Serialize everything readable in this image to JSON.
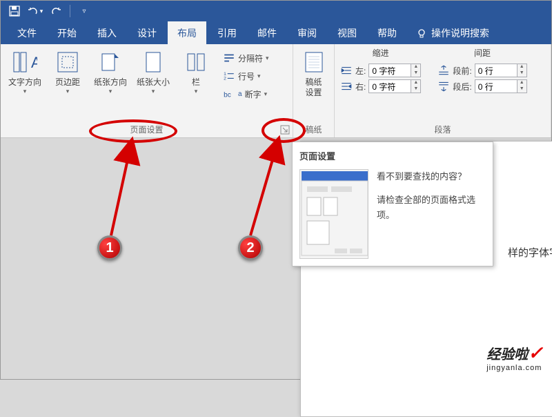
{
  "qat": {
    "save": "保存",
    "undo": "撤销",
    "redo": "重做"
  },
  "tabs": {
    "file": "文件",
    "home": "开始",
    "insert": "插入",
    "design": "设计",
    "layout": "布局",
    "references": "引用",
    "mailings": "邮件",
    "review": "审阅",
    "view": "视图",
    "help": "帮助",
    "tellme": "操作说明搜索"
  },
  "ribbon": {
    "page_setup": {
      "label": "页面设置",
      "text_direction": "文字方向",
      "margins": "页边距",
      "orientation": "纸张方向",
      "size": "纸张大小",
      "columns": "栏",
      "breaks": "分隔符",
      "line_numbers": "行号",
      "hyphenation": "断字"
    },
    "manuscript": {
      "label": "稿纸",
      "settings": "稿纸\n设置"
    },
    "paragraph": {
      "label": "段落",
      "indent_head": "缩进",
      "spacing_head": "间距",
      "left_label": "左:",
      "left_value": "0 字符",
      "right_label": "右:",
      "right_value": "0 字符",
      "before_label": "段前:",
      "before_value": "0 行",
      "after_label": "段后:",
      "after_value": "0 行"
    }
  },
  "tooltip": {
    "title": "页面设置",
    "line1": "看不到要查找的内容？",
    "line2": "请检查全部的页面格式选项。"
  },
  "document": {
    "visible_text": "样的字体字"
  },
  "annotations": {
    "badge1": "1",
    "badge2": "2"
  },
  "watermark": {
    "brand": "经验啦",
    "url": "jingyanla.com",
    "check": "✓"
  }
}
